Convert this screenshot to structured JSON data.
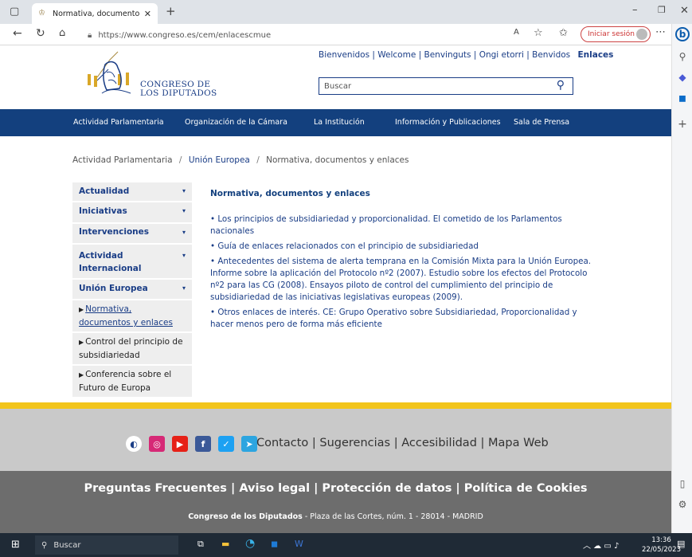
{
  "browser": {
    "tab_title": "Normativa, documentos y enlace",
    "url": "https://www.congreso.es/cem/enlacescmue",
    "signin_label": "Iniciar sesión",
    "icons": [
      "window-icon",
      "back-icon",
      "refresh-icon",
      "home-icon",
      "lock-icon",
      "read-aloud-icon",
      "favorite-icon",
      "favorites-icon",
      "collections-icon",
      "more-icon",
      "bing-icon"
    ]
  },
  "header": {
    "languages": "Bienvenidos | Welcome | Benvinguts | Ongi etorri | Benvidos",
    "current_section": "Enlaces",
    "logo_line1": "CONGRESO DE",
    "logo_line2": "LOS DIPUTADOS",
    "search_placeholder": "Buscar"
  },
  "nav": {
    "items": [
      "Actividad Parlamentaria",
      "Organización de la Cámara",
      "La Institución",
      "Información y Publicaciones",
      "Sala de Prensa"
    ]
  },
  "breadcrumb": {
    "items": [
      "Actividad Parlamentaria",
      "Unión Europea",
      "Normativa, documentos y enlaces"
    ]
  },
  "leftmenu": {
    "sections": [
      "Actualidad",
      "Iniciativas",
      "Intervenciones",
      "Actividad Internacional",
      "Unión Europea"
    ],
    "subitems": [
      "Normativa, documentos y enlaces",
      "Control del principio de subsidiariedad",
      "Conferencia sobre el Futuro de Europa"
    ]
  },
  "content": {
    "title": "Normativa, documentos y enlaces",
    "items": [
      "• Los principios de subsidiariedad y proporcionalidad. El cometido de los Parlamentos nacionales",
      "• Guía de enlaces relacionados con el principio de subsidiariedad",
      "• Antecedentes del sistema de alerta temprana en la Comisión Mixta para la Unión Europea. Informe sobre la aplicación del Protocolo nº2 (2007). Estudio sobre los efectos del Protocolo nº2 para las CG (2008). Ensayos piloto de control del cumplimiento del principio de subsidiariedad de las iniciativas legislativas europeas (2009).",
      "• Otros enlaces de interés. CE: Grupo Operativo sobre Subsidiariedad, Proporcionalidad y hacer menos pero de forma más eficiente"
    ]
  },
  "footer": {
    "links": "Contacto | Sugerencias | Accesibilidad | Mapa Web",
    "legal": "Preguntas Frecuentes | Aviso legal | Protección de datos | Política de Cookies",
    "address_bold": "Congreso de los Diputados",
    "address_rest": " - Plaza de las Cortes, núm. 1 - 28014 - MADRID",
    "social": [
      "fediverse-icon",
      "instagram-icon",
      "youtube-icon",
      "facebook-icon",
      "twitter-icon",
      "telegram-icon"
    ]
  },
  "taskbar": {
    "search_label": "Buscar",
    "time": "13:36",
    "date": "22/05/2023"
  },
  "colors": {
    "nav_bg": "#13407e",
    "link": "#1a3d86",
    "footer_accent": "#f2c51c",
    "footer_dark": "#6d6d6d"
  }
}
